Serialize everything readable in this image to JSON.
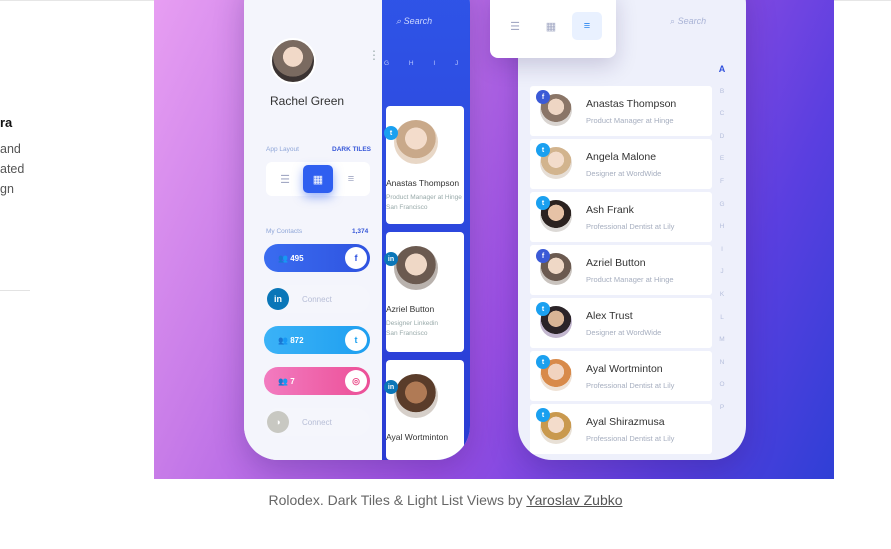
{
  "left_text": {
    "bold": "ra",
    "lines": [
      "and",
      "ated",
      "gn"
    ]
  },
  "phone_left": {
    "username": "Rachel Green",
    "menu_icon": "more-vertical-icon",
    "search_placeholder": "Search",
    "alphabet": "G H I J",
    "app_layout_label": "App Layout",
    "layout_value": "DARK TILES",
    "contacts_label": "My Contacts",
    "contacts_count": "1,374",
    "pills": [
      {
        "label": "495",
        "icon": "facebook-icon",
        "glyph": "f"
      },
      {
        "label": "Connect",
        "icon": "linkedin-icon",
        "glyph": "in"
      },
      {
        "label": "872",
        "icon": "twitter-icon",
        "glyph": "t"
      },
      {
        "label": "7",
        "icon": "dribbble-icon",
        "glyph": "◎"
      },
      {
        "label": "Connect",
        "icon": "other-service-icon",
        "glyph": "◑"
      }
    ],
    "tiles": [
      {
        "name": "Anastas Thompson",
        "sub1": "Product Manager at Hinge",
        "sub2": "San Francisco",
        "badge": "twitter-icon"
      },
      {
        "name": "Azriel Button",
        "sub1": "Designer Linkedin",
        "sub2": "San Francisco",
        "badge": "linkedin-icon"
      },
      {
        "name": "Ayal Wortminton",
        "sub1": "",
        "sub2": "",
        "badge": "linkedin-icon"
      }
    ]
  },
  "phone_right": {
    "search_placeholder": "Search",
    "alphabet": [
      "A",
      "B",
      "C",
      "D",
      "E",
      "F",
      "G",
      "H",
      "I",
      "J",
      "K",
      "L",
      "M",
      "N",
      "O",
      "P"
    ],
    "contacts": [
      {
        "name": "Anastas Thompson",
        "title": "Product Manager at Hinge",
        "badge": "facebook-icon"
      },
      {
        "name": "Angela Malone",
        "title": "Designer at WordWide",
        "badge": "twitter-icon"
      },
      {
        "name": "Ash Frank",
        "title": "Professional Dentist at Lily",
        "badge": "twitter-icon"
      },
      {
        "name": "Azriel Button",
        "title": "Product Manager at Hinge",
        "badge": "facebook-icon"
      },
      {
        "name": "Alex Trust",
        "title": "Designer at WordWide",
        "badge": "twitter-icon"
      },
      {
        "name": "Ayal Wortminton",
        "title": "Professional Dentist at Lily",
        "badge": "twitter-icon"
      },
      {
        "name": "Ayal Shirazmusa",
        "title": "Professional Dentist at Lily",
        "badge": "twitter-icon"
      }
    ]
  },
  "caption": {
    "text": "Rolodex. Dark Tiles & Light List Views by ",
    "author": "Yaroslav Zubko"
  }
}
